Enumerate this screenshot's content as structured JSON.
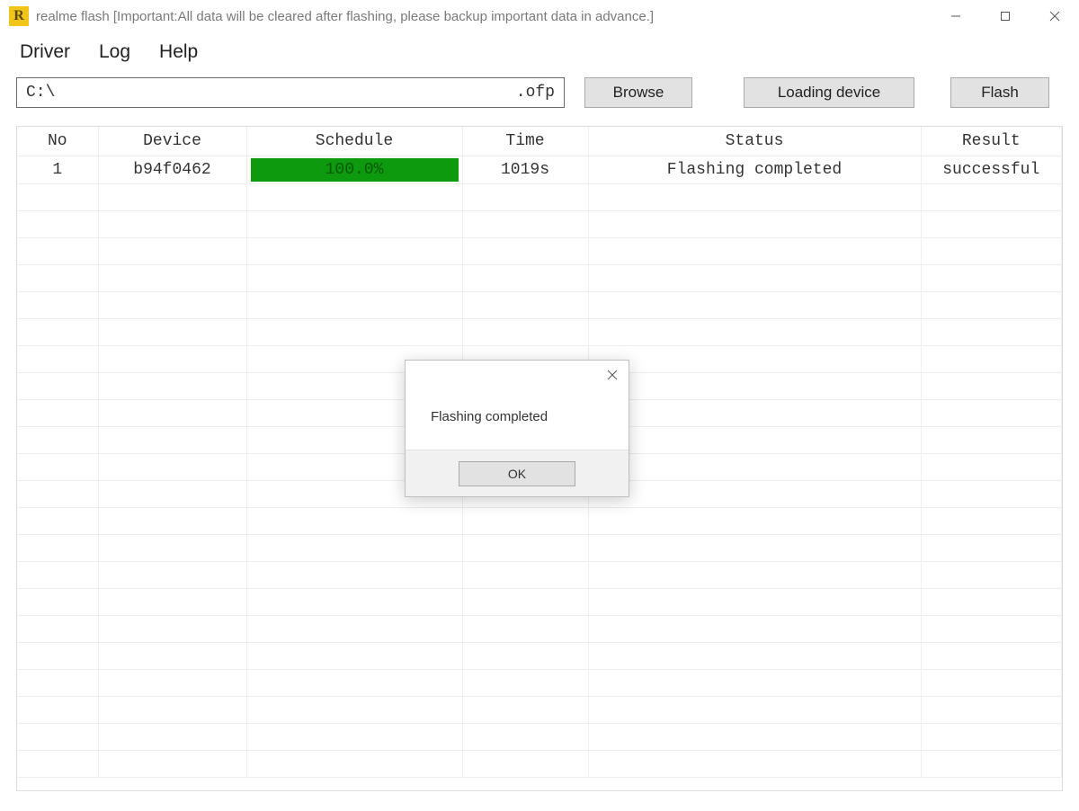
{
  "window": {
    "title": "realme flash [Important:All data will be cleared after flashing, please backup important data in advance.]"
  },
  "menubar": {
    "items": [
      {
        "label": "Driver"
      },
      {
        "label": "Log"
      },
      {
        "label": "Help"
      }
    ]
  },
  "toolbar": {
    "path_left": "C:\\",
    "path_right": ".ofp",
    "browse_label": "Browse",
    "loading_label": "Loading device",
    "flash_label": "Flash"
  },
  "table": {
    "headers": {
      "no": "No",
      "device": "Device",
      "schedule": "Schedule",
      "time": "Time",
      "status": "Status",
      "result": "Result"
    },
    "rows": [
      {
        "no": "1",
        "device": "b94f0462",
        "schedule_percent": "100.0%",
        "time": "1019s",
        "status": "Flashing completed",
        "result": "successful"
      }
    ]
  },
  "dialog": {
    "message": "Flashing completed",
    "ok_label": "OK"
  }
}
